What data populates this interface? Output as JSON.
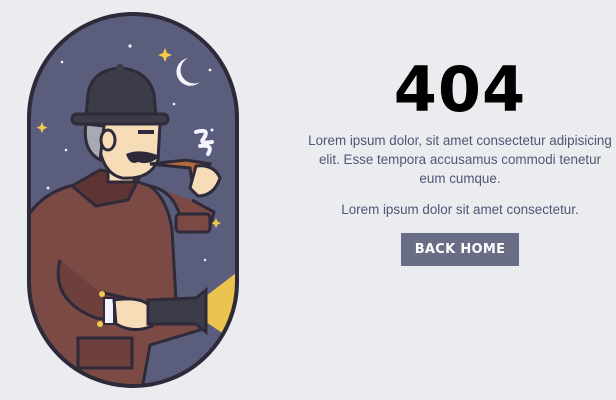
{
  "error": {
    "code": "404",
    "message_primary": "Lorem ipsum dolor, sit amet consectetur adipisicing elit. Esse tempora accusamus commodi tenetur eum cumque.",
    "message_secondary": "Lorem ipsum dolor sit amet consectetur.",
    "button_label": "BACK HOME"
  },
  "illustration": {
    "subject": "detective-with-pipe-and-flashlight",
    "icons": [
      "moon-icon",
      "star-icon"
    ]
  },
  "colors": {
    "background": "#ebecef",
    "night_sky": "#5b5d7c",
    "coat": "#7b4a45",
    "text": "#4f5677",
    "button": "#6a6d86",
    "heading": "#000000"
  }
}
